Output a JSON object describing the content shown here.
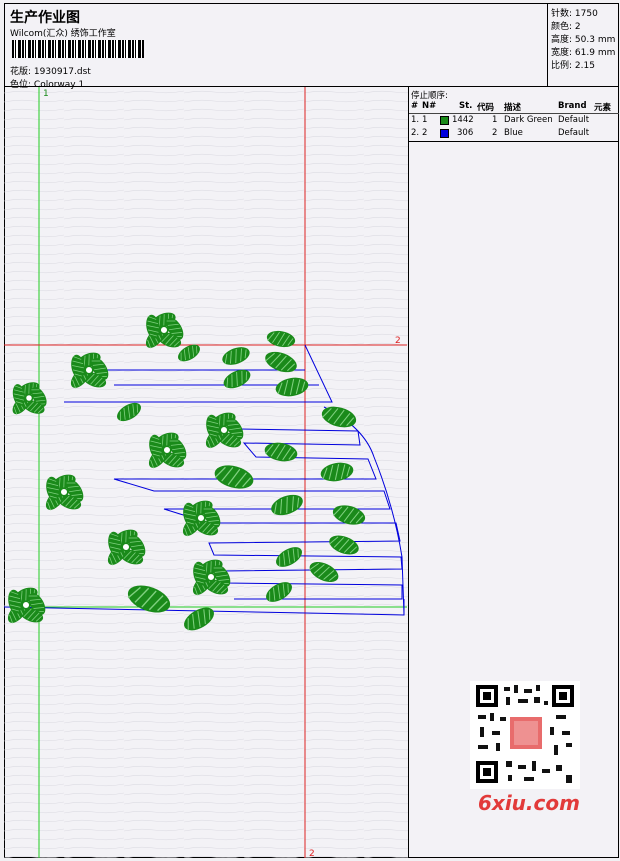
{
  "header": {
    "title": "生产作业图",
    "studio": "Wilcom(汇众) 绣饰工作室",
    "file_label": "花版:",
    "file_name": "1930917.dst",
    "color_label": "色位:",
    "colorway": "Colorway 1"
  },
  "stats": [
    {
      "label": "针数:",
      "value": "1750"
    },
    {
      "label": "颜色:",
      "value": "2"
    },
    {
      "label": "高度:",
      "value": "50.3 mm"
    },
    {
      "label": "宽度:",
      "value": "61.9 mm"
    },
    {
      "label": "比例:",
      "value": "2.15"
    }
  ],
  "stop_sequence": {
    "title": "停止顺序:",
    "headers": {
      "num": "#",
      "n": "N#",
      "st": "St.",
      "code": "代码",
      "desc": "描述",
      "brand": "Brand",
      "element": "元素"
    },
    "rows": [
      {
        "num": "1.",
        "n": "1",
        "color": "#1a8a1a",
        "st": "1442",
        "code": "1",
        "desc": "Dark Green",
        "brand": "Default"
      },
      {
        "num": "2.",
        "n": "2",
        "color": "#0000dd",
        "st": "306",
        "code": "2",
        "desc": "Blue",
        "brand": "Default"
      }
    ]
  },
  "guides": {
    "green_top": "1",
    "red_right": "2",
    "red_bottom": "2"
  },
  "colors": {
    "stitch_green": "#1a8a1a",
    "stitch_blue": "#0000dd",
    "guide_green": "#22cc22",
    "guide_red": "#dd2222",
    "watermark": "#e23a3a"
  },
  "watermark": "6xiu.com"
}
